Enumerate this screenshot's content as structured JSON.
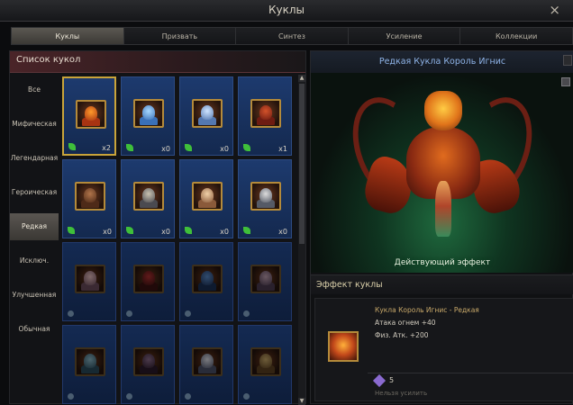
{
  "window": {
    "title": "Куклы",
    "close_glyph": "×"
  },
  "tabs": [
    {
      "label": "Куклы",
      "active": true
    },
    {
      "label": "Призвать",
      "active": false
    },
    {
      "label": "Синтез",
      "active": false
    },
    {
      "label": "Усиление",
      "active": false
    },
    {
      "label": "Коллекции",
      "active": false
    }
  ],
  "doll_list": {
    "header": "Список кукол",
    "categories": [
      {
        "label": "Все",
        "active": false
      },
      {
        "label": "Мифическая",
        "active": false
      },
      {
        "label": "Легендарная",
        "active": false
      },
      {
        "label": "Героическая",
        "active": false
      },
      {
        "label": "Редкая",
        "active": true
      },
      {
        "label": "Исключ.",
        "active": false
      },
      {
        "label": "Улучшенная",
        "active": false
      },
      {
        "label": "Обычная",
        "active": false
      }
    ],
    "dolls": [
      {
        "count": "x2",
        "owned": true,
        "selected": true,
        "icon": "fire-demon-doll"
      },
      {
        "count": "x0",
        "owned": true,
        "selected": false,
        "icon": "ice-spirit-doll"
      },
      {
        "count": "x0",
        "owned": true,
        "selected": false,
        "icon": "ice-knight-doll"
      },
      {
        "count": "x1",
        "owned": true,
        "selected": false,
        "icon": "red-warrior-doll"
      },
      {
        "count": "x0",
        "owned": true,
        "selected": false,
        "icon": "beast-warrior-doll"
      },
      {
        "count": "x0",
        "owned": true,
        "selected": false,
        "icon": "armored-knight-doll"
      },
      {
        "count": "x0",
        "owned": true,
        "selected": false,
        "icon": "priestess-doll"
      },
      {
        "count": "x0",
        "owned": true,
        "selected": false,
        "icon": "silver-knight-doll"
      },
      {
        "count": "",
        "owned": false,
        "selected": false,
        "icon": "girl-doll"
      },
      {
        "count": "",
        "owned": false,
        "selected": false,
        "icon": "dark-warrior-doll"
      },
      {
        "count": "",
        "owned": false,
        "selected": false,
        "icon": "blue-mage-doll"
      },
      {
        "count": "",
        "owned": false,
        "selected": false,
        "icon": "gray-knight-doll"
      },
      {
        "count": "",
        "owned": false,
        "selected": false,
        "icon": "teal-warrior-doll"
      },
      {
        "count": "",
        "owned": false,
        "selected": false,
        "icon": "dark-knight-doll"
      },
      {
        "count": "",
        "owned": false,
        "selected": false,
        "icon": "hooded-mage-doll"
      },
      {
        "count": "",
        "owned": false,
        "selected": false,
        "icon": "golden-knight-doll"
      }
    ]
  },
  "detail": {
    "title": "Редкая Кукла Король Игнис",
    "active_effect_label": "Действующий эффект"
  },
  "effect": {
    "header": "Эффект куклы",
    "name": "Кукла Король Игнис - Редкая",
    "stat1": "Атака огнем +40",
    "stat2": "Физ. Атк. +200",
    "gem_count": "5",
    "cannot_enhance": "Нельзя усилить"
  },
  "colors": {
    "accent_blue": "#8fb4e8",
    "gold_border": "#c9a43a",
    "green_leaf": "#3fbf3a",
    "header_red": "#4a2428"
  }
}
